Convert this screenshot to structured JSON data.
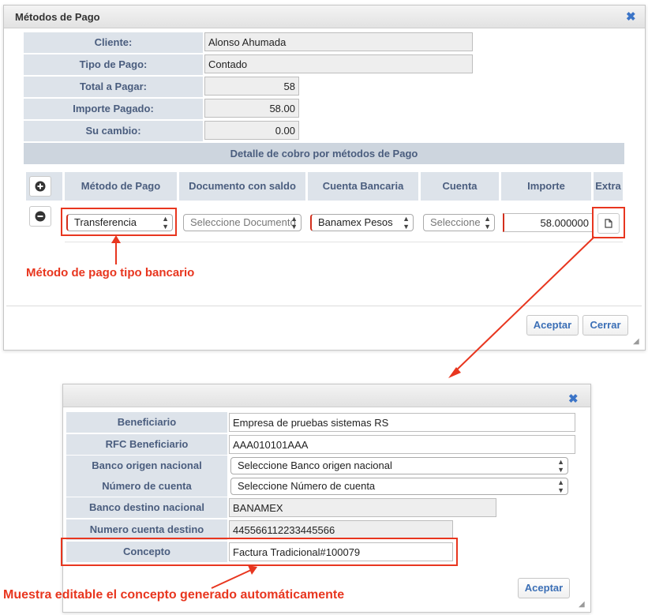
{
  "dialog1": {
    "title": "Métodos de Pago",
    "close_glyph": "✖",
    "fields": {
      "cliente": {
        "label": "Cliente:",
        "value": "Alonso Ahumada"
      },
      "tipo_pago": {
        "label": "Tipo de Pago:",
        "value": "Contado"
      },
      "total": {
        "label": "Total a Pagar:",
        "value": "58"
      },
      "importe_pagado": {
        "label": "Importe Pagado:",
        "value": "58.00"
      },
      "cambio": {
        "label": "Su cambio:",
        "value": "0.00"
      }
    },
    "section_header": "Detalle de cobro por métodos de Pago",
    "table": {
      "headers": [
        "Método de Pago",
        "Documento con saldo",
        "Cuenta Bancaria",
        "Cuenta",
        "Importe",
        "Extra"
      ],
      "row": {
        "metodo": "Transferencia",
        "documento": "Seleccione Documento",
        "cuenta_bancaria": "Banamex Pesos",
        "cuenta": "Seleccione",
        "importe": "58.000000"
      }
    },
    "buttons": {
      "accept": "Aceptar",
      "close": "Cerrar"
    }
  },
  "dialog2": {
    "close_glyph": "✖",
    "fields": {
      "beneficiario": {
        "label": "Beneficiario",
        "value": "Empresa de pruebas sistemas RS"
      },
      "rfc": {
        "label": "RFC Beneficiario",
        "value": "AAA010101AAA"
      },
      "banco_origen": {
        "label": "Banco origen nacional",
        "value": "Seleccione Banco origen nacional"
      },
      "num_cuenta": {
        "label": "Número de cuenta",
        "value": "Seleccione Número de cuenta"
      },
      "banco_destino": {
        "label": "Banco destino nacional",
        "value": "BANAMEX"
      },
      "cuenta_destino": {
        "label": "Numero cuenta destino",
        "value": "445566112233445566"
      },
      "concepto": {
        "label": "Concepto",
        "value": "Factura Tradicional#100079"
      }
    },
    "buttons": {
      "accept": "Aceptar"
    }
  },
  "annotations": {
    "metodo": "Método de pago tipo bancario",
    "concepto": "Muestra editable el concepto generado automáticamente"
  },
  "icons": [
    "close-icon",
    "add-row-icon",
    "remove-row-icon",
    "document-icon",
    "select-caret-icon",
    "resize-grip-icon"
  ],
  "colors": {
    "accent_red": "#e8361f",
    "label_bg": "#dde3ea",
    "label_text": "#4a5d7e",
    "link_blue": "#3b6fb6"
  }
}
